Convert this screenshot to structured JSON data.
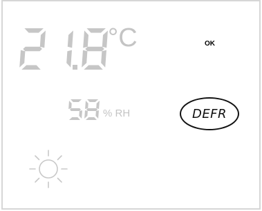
{
  "display": {
    "temperature": {
      "digits": [
        "2",
        "1",
        "8"
      ],
      "value": "21.8",
      "unit": "°C"
    },
    "humidity": {
      "digits": [
        "5",
        "8"
      ],
      "value": "58",
      "unit": "% RH"
    },
    "status": "OK",
    "defrost_button": {
      "label": "DEFR"
    },
    "mode_icon": "sun-icon",
    "colors": {
      "segment_gray": "#c6c6c6",
      "text_black": "#111111",
      "border": "#d6d6d6"
    }
  }
}
